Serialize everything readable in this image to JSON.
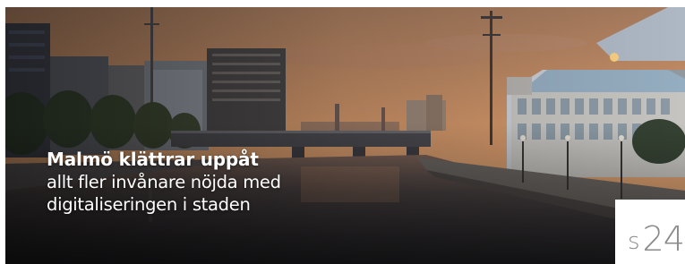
{
  "article": {
    "headline": "Malmö klättrar uppåt",
    "subline_1": "allt fler invånare nöjda med",
    "subline_2": "digitaliseringen i staden"
  },
  "page_ref": {
    "prefix": "s",
    "number": "24"
  },
  "photo": {
    "subject": "Malmö canal at dusk with bridge, office buildings and glass-roofed building",
    "sky_top": "#b9865f",
    "sky_horizon": "#e6a36f",
    "water": "#3c3a3d"
  }
}
